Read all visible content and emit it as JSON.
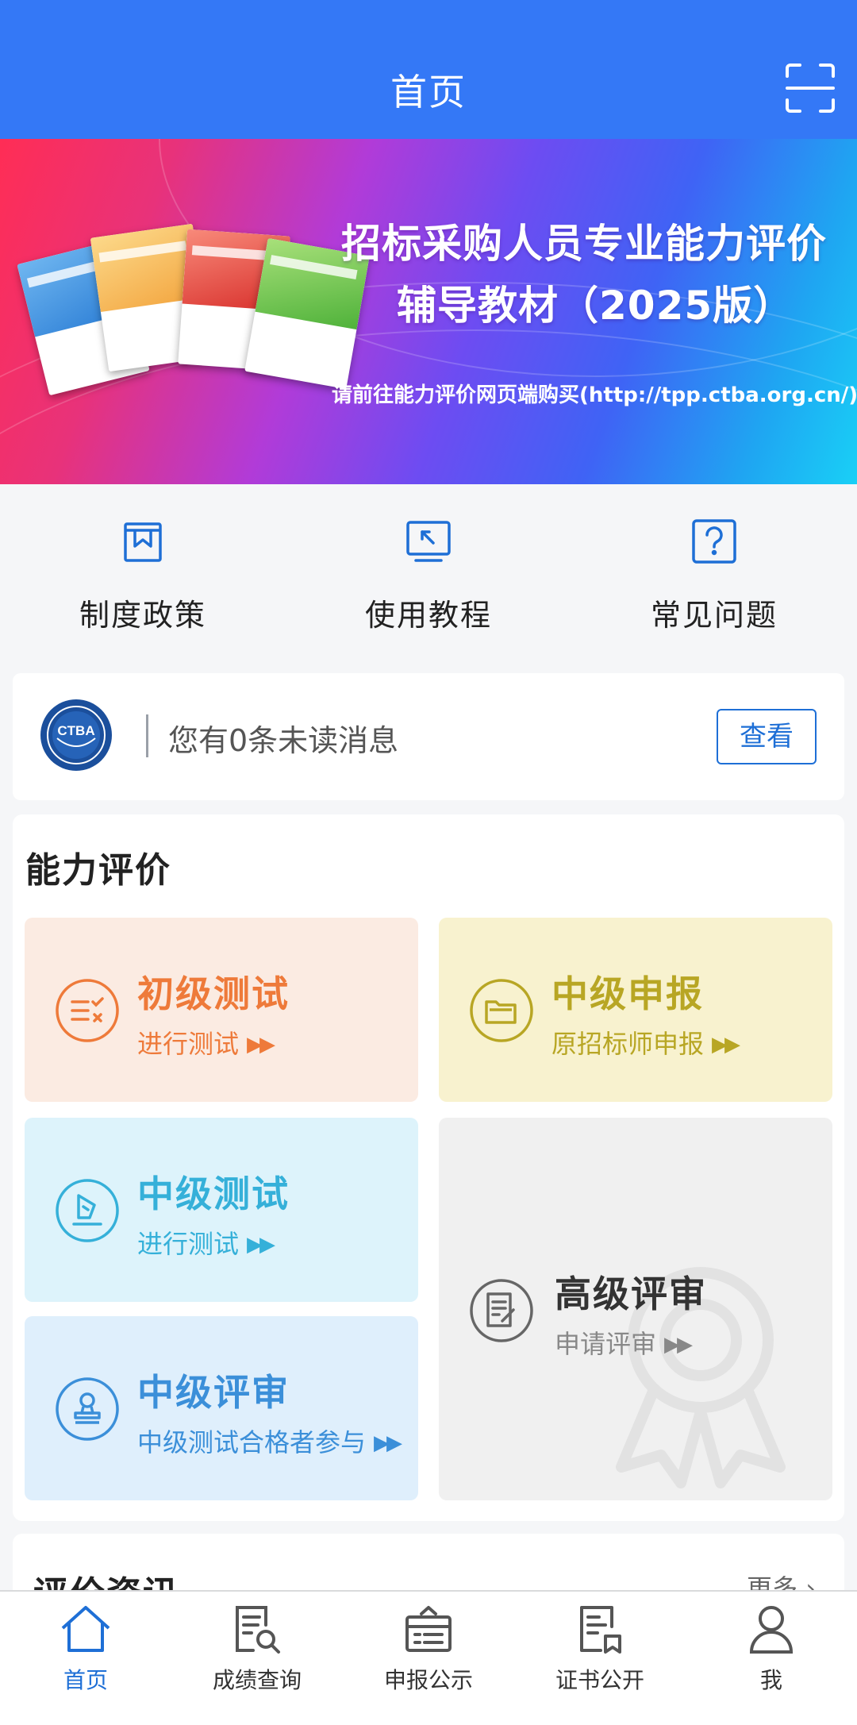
{
  "header": {
    "title": "首页",
    "scan_icon": "scan-icon"
  },
  "banner": {
    "title_line1": "招标采购人员专业能力评价",
    "title_line2": "辅导教材（2025版）",
    "subtitle": "请前往能力评价网页端购买(http://tpp.ctba.org.cn/)"
  },
  "menu": {
    "items": [
      {
        "label": "制度政策",
        "icon": "bookmark-icon"
      },
      {
        "label": "使用教程",
        "icon": "tutorial-icon"
      },
      {
        "label": "常见问题",
        "icon": "question-icon"
      }
    ]
  },
  "message": {
    "logo_text": "CTBA",
    "text": "您有0条未读消息",
    "button": "查看"
  },
  "ability": {
    "title": "能力评价",
    "tiles": [
      {
        "title": "初级测试",
        "sub": "进行测试",
        "color": "#ee7a3a"
      },
      {
        "title": "中级申报",
        "sub": "原招标师申报",
        "color": "#b8a624"
      },
      {
        "title": "中级测试",
        "sub": "进行测试",
        "color": "#35b0d9"
      },
      {
        "title": "中级评审",
        "sub": "中级测试合格者参与",
        "color": "#3b8fd9"
      },
      {
        "title": "高级评审",
        "sub": "申请评审",
        "color": "#333333"
      }
    ]
  },
  "news": {
    "title": "评价资讯",
    "more": "更多"
  },
  "tabbar": {
    "tabs": [
      {
        "label": "首页",
        "icon": "home-icon",
        "active": true
      },
      {
        "label": "成绩查询",
        "icon": "score-search-icon",
        "active": false
      },
      {
        "label": "申报公示",
        "icon": "announcement-icon",
        "active": false
      },
      {
        "label": "证书公开",
        "icon": "certificate-icon",
        "active": false
      },
      {
        "label": "我",
        "icon": "user-icon",
        "active": false
      }
    ]
  },
  "colors": {
    "primary": "#3478f6",
    "accent": "#1e6fd6"
  }
}
